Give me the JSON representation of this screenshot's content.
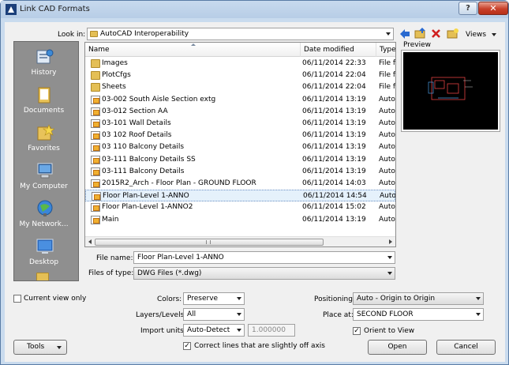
{
  "window": {
    "title": "Link CAD Formats",
    "help_label": "?",
    "close_label": "✕"
  },
  "toolbar": {
    "look_in_label": "Look in:",
    "look_in_value": "AutoCAD Interoperability",
    "views_label": "Views"
  },
  "places": [
    {
      "label": "History",
      "icon": "history-icon"
    },
    {
      "label": "Documents",
      "icon": "documents-icon"
    },
    {
      "label": "Favorites",
      "icon": "favorites-icon"
    },
    {
      "label": "My Computer",
      "icon": "my-computer-icon"
    },
    {
      "label": "My Network...",
      "icon": "network-icon"
    },
    {
      "label": "Desktop",
      "icon": "desktop-icon"
    }
  ],
  "filelist": {
    "columns": [
      "Name",
      "Date modified",
      "Type"
    ],
    "rows": [
      {
        "name": "Images",
        "date": "06/11/2014 22:33",
        "type": "File f",
        "kind": "folder"
      },
      {
        "name": "PlotCfgs",
        "date": "06/11/2014 22:04",
        "type": "File f",
        "kind": "folder"
      },
      {
        "name": "Sheets",
        "date": "06/11/2014 22:04",
        "type": "File f",
        "kind": "folder"
      },
      {
        "name": "03-002 South Aisle Section extg",
        "date": "06/11/2014 13:19",
        "type": "Auto",
        "kind": "dwg"
      },
      {
        "name": "03-012 Section AA",
        "date": "06/11/2014 13:19",
        "type": "Auto",
        "kind": "dwg"
      },
      {
        "name": "03-101 Wall Details",
        "date": "06/11/2014 13:19",
        "type": "Auto",
        "kind": "dwg"
      },
      {
        "name": "03 102 Roof Details",
        "date": "06/11/2014 13:19",
        "type": "Auto",
        "kind": "dwg"
      },
      {
        "name": "03 110 Balcony Details",
        "date": "06/11/2014 13:19",
        "type": "Auto",
        "kind": "dwg"
      },
      {
        "name": "03-111 Balcony Details SS",
        "date": "06/11/2014 13:19",
        "type": "Auto",
        "kind": "dwg"
      },
      {
        "name": "03-111 Balcony Details",
        "date": "06/11/2014 13:19",
        "type": "Auto",
        "kind": "dwg"
      },
      {
        "name": "2015R2_Arch - Floor Plan - GROUND FLOOR",
        "date": "06/11/2014 14:03",
        "type": "Auto",
        "kind": "dwg"
      },
      {
        "name": "Floor Plan-Level 1-ANNO",
        "date": "06/11/2014 14:54",
        "type": "Auto",
        "kind": "dwg",
        "selected": true
      },
      {
        "name": "Floor Plan-Level 1-ANNO2",
        "date": "06/11/2014 15:02",
        "type": "Auto",
        "kind": "dwg"
      },
      {
        "name": "Main",
        "date": "06/11/2014 13:19",
        "type": "Auto",
        "kind": "dwg"
      }
    ]
  },
  "preview": {
    "label": "Preview"
  },
  "file_name": {
    "label": "File name:",
    "value": "Floor Plan-Level 1-ANNO"
  },
  "files_of_type": {
    "label": "Files of type:",
    "value": "DWG Files  (*.dwg)"
  },
  "options": {
    "current_view_only": "Current view only",
    "colors_label": "Colors:",
    "colors_value": "Preserve",
    "layers_label": "Layers/Levels:",
    "layers_value": "All",
    "import_units_label": "Import units:",
    "import_units_value": "Auto-Detect",
    "scale_value": "1.000000",
    "correct_lines": "Correct lines that are slightly off axis",
    "positioning_label": "Positioning:",
    "positioning_value": "Auto - Origin to Origin",
    "place_at_label": "Place at:",
    "place_at_value": "SECOND FLOOR",
    "orient_to_view": "Orient to View"
  },
  "buttons": {
    "tools": "Tools",
    "open": "Open",
    "cancel": "Cancel"
  }
}
